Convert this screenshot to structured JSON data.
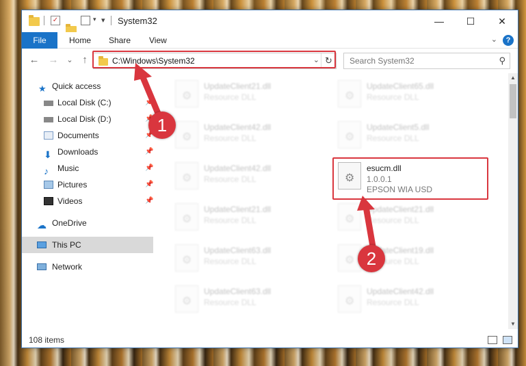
{
  "window": {
    "title": "System32",
    "min_glyph": "—",
    "max_glyph": "☐",
    "close_glyph": "✕"
  },
  "ribbon": {
    "tabs": [
      "File",
      "Home",
      "Share",
      "View"
    ],
    "expand_glyph": "⌄",
    "help_glyph": "?"
  },
  "nav": {
    "back_glyph": "←",
    "forward_glyph": "→",
    "recent_glyph": "⌄",
    "up_glyph": "↑"
  },
  "address": {
    "path": "C:\\Windows\\System32",
    "dropdown_glyph": "⌄",
    "refresh_glyph": "↻"
  },
  "search": {
    "placeholder": "Search System32",
    "icon_glyph": "⚲"
  },
  "sidebar": {
    "pin_glyph": "📌",
    "items": [
      {
        "label": "Quick access",
        "icon": "star-icon",
        "pinned": false
      },
      {
        "label": "Local Disk (C:)",
        "icon": "drive-icon",
        "pinned": true
      },
      {
        "label": "Local Disk (D:)",
        "icon": "drive-icon",
        "pinned": true
      },
      {
        "label": "Documents",
        "icon": "documents-icon",
        "pinned": true
      },
      {
        "label": "Downloads",
        "icon": "download-icon",
        "pinned": true
      },
      {
        "label": "Music",
        "icon": "music-icon",
        "pinned": true
      },
      {
        "label": "Pictures",
        "icon": "pictures-icon",
        "pinned": true
      },
      {
        "label": "Videos",
        "icon": "videos-icon",
        "pinned": true
      },
      {
        "label": "OneDrive",
        "icon": "cloud-icon",
        "pinned": false
      },
      {
        "label": "This PC",
        "icon": "computer-icon",
        "pinned": false,
        "selected": true
      },
      {
        "label": "Network",
        "icon": "network-icon",
        "pinned": false
      }
    ]
  },
  "files": {
    "left_column": [
      {
        "name": "UpdateClient21.dll",
        "desc": "Resource DLL"
      },
      {
        "name": "UpdateClient42.dll",
        "desc": "Resource DLL"
      },
      {
        "name": "UpdateClient42.dll",
        "desc": "Resource DLL"
      },
      {
        "name": "UpdateClient21.dll",
        "desc": "Resource DLL"
      },
      {
        "name": "UpdateClient63.dll",
        "desc": "Resource DLL"
      },
      {
        "name": "UpdateClient63.dll",
        "desc": "Resource DLL"
      }
    ],
    "right_column": [
      {
        "name": "UpdateClient65.dll",
        "desc": "Resource DLL"
      },
      {
        "name": "UpdateClient5.dll",
        "desc": "Resource DLL"
      },
      {
        "name": "esucm.dll",
        "desc": "1.0.0.1",
        "desc2": "EPSON WIA USD",
        "highlighted": true
      },
      {
        "name": "UpdateClient21.dll",
        "desc": "Resource DLL"
      },
      {
        "name": "UpdateClient19.dll",
        "desc": "Resource DLL"
      },
      {
        "name": "UpdateClient42.dll",
        "desc": "Resource DLL"
      }
    ]
  },
  "status": {
    "item_count": "108 items"
  },
  "callouts": [
    "1",
    "2"
  ],
  "colors": {
    "accent": "#1a73c8",
    "highlight": "#d9363e"
  }
}
